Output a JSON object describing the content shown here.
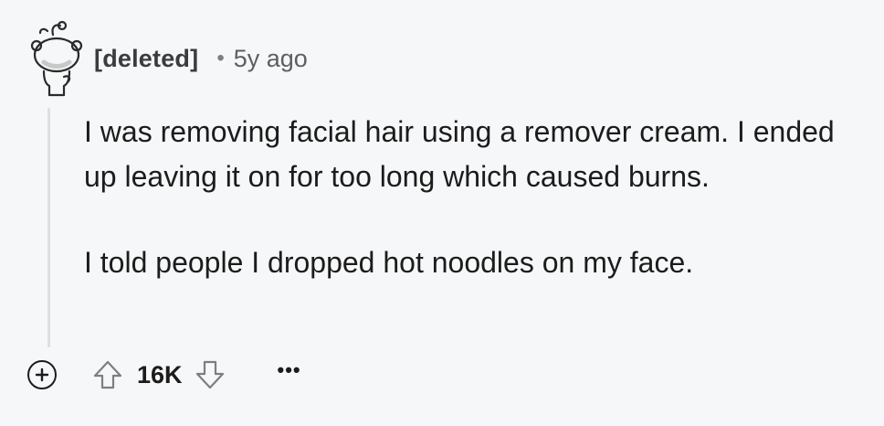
{
  "comment": {
    "author": "[deleted]",
    "separator": "•",
    "time": "5y ago",
    "paragraphs": [
      "I was removing facial hair using a remover cream. I ended up leaving it on for too long which caused burns.",
      "I told people I dropped hot noodles on my face."
    ],
    "score": "16K",
    "more_label": "•••"
  },
  "icons": {
    "avatar": "reddit-snoo-outline-icon",
    "expand": "plus-circle-icon",
    "upvote": "arrow-up-outline-icon",
    "downvote": "arrow-down-outline-icon"
  },
  "colors": {
    "background": "#f6f7f8",
    "text": "#1c1c1c",
    "muted": "#5c5f62",
    "thread_line": "#dcdfe2"
  }
}
